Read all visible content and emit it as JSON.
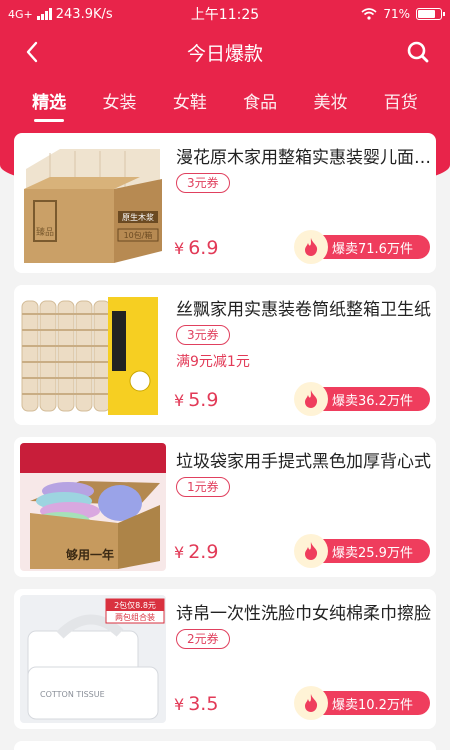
{
  "status_bar": {
    "network": "4G+",
    "speed": "243.9K/s",
    "time": "上午11:25",
    "battery": "71%"
  },
  "nav": {
    "title": "今日爆款",
    "back_icon": "chevron-left-icon",
    "search_icon": "search-icon"
  },
  "tabs": [
    {
      "label": "精选"
    },
    {
      "label": "女装"
    },
    {
      "label": "女鞋"
    },
    {
      "label": "食品"
    },
    {
      "label": "美妆"
    },
    {
      "label": "百货"
    }
  ],
  "products": [
    {
      "title": "漫花原木家用整箱实惠装婴儿面巾纸",
      "coupon": "3元券",
      "promo": "",
      "price": "6.9",
      "sold": "爆卖71.6万件"
    },
    {
      "title": "丝飘家用实惠装卷筒纸整箱卫生纸",
      "coupon": "3元券",
      "promo": "满9元减1元",
      "price": "5.9",
      "sold": "爆卖36.2万件"
    },
    {
      "title": "垃圾袋家用手提式黑色加厚背心式",
      "coupon": "1元券",
      "promo": "",
      "price": "2.9",
      "sold": "爆卖25.9万件"
    },
    {
      "title": "诗帛一次性洗脸巾女纯棉柔巾擦脸",
      "coupon": "2元券",
      "promo": "",
      "price": "3.5",
      "sold": "爆卖10.2万件"
    }
  ],
  "images": {
    "box_label": "原生木浆",
    "box_count": "10包/箱",
    "box_brand": "臻品",
    "bag_text": "够用一年",
    "tissue_badge_line1": "2包仅8.8元",
    "tissue_badge_line2": "两包组合装",
    "tissue_text": "COTTON TISSUE"
  },
  "currency": "¥",
  "colors": {
    "accent": "#e8244a",
    "price": "#e23a57"
  }
}
